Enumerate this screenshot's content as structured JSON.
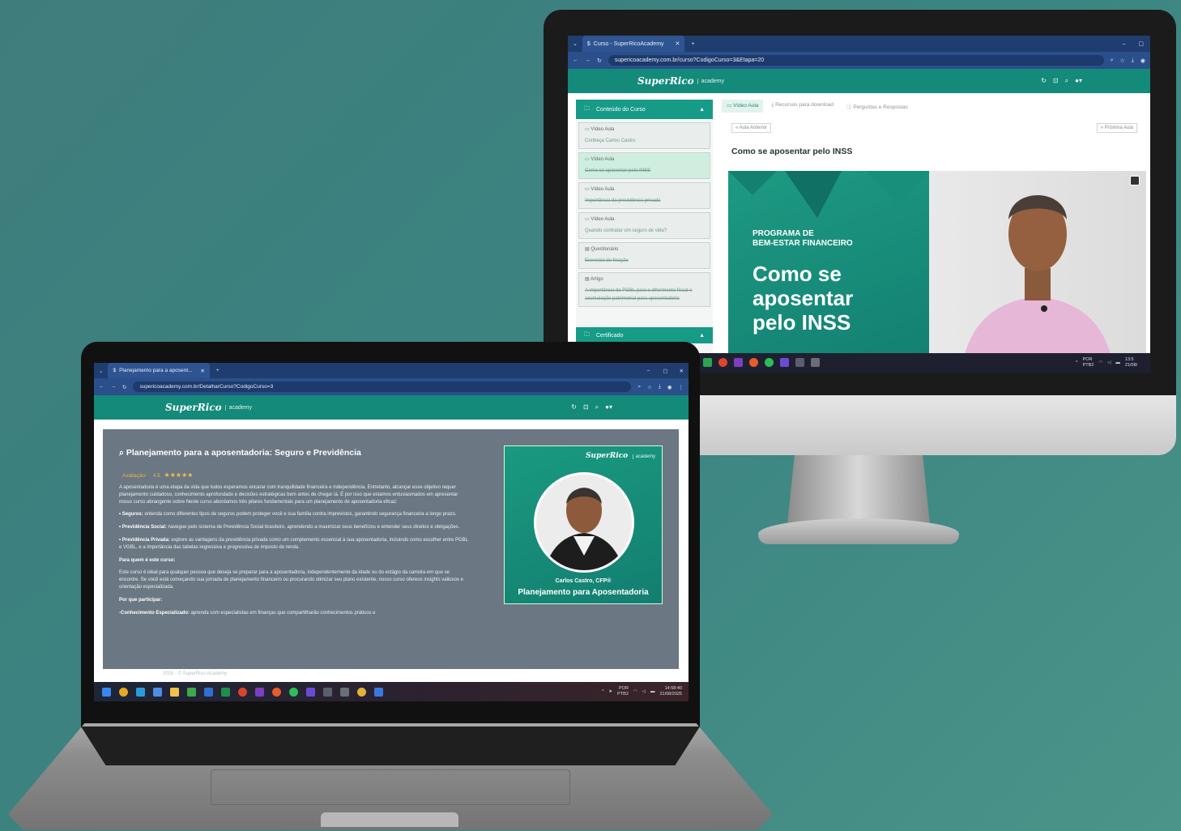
{
  "monitor": {
    "browser": {
      "tab_title": "Curso - SuperRicoAcademy",
      "url": "supericoacademy.com.br/curso?CodigoCurso=3&Etapa=20"
    },
    "app": {
      "logo": "SuperRico",
      "logo_sub": "academy"
    },
    "sidebar": {
      "header": "Conteúdo do Curso",
      "items": [
        {
          "kind": "Vídeo Aula",
          "title": "Conheça Carlos Castro"
        },
        {
          "kind": "Vídeo Aula",
          "title": "Como se aposentar pelo INSS"
        },
        {
          "kind": "Vídeo Aula",
          "title": "Importância da previdência privada"
        },
        {
          "kind": "Vídeo Aula",
          "title": "Quando contratar um seguro de vida?"
        },
        {
          "kind": "Questionário",
          "title": "Exercício de fixação"
        },
        {
          "kind": "Artigo",
          "title": "A importância do PGBL para o diferimento fiscal e acumulação patrimonial para aposentadoria"
        }
      ],
      "certificate": "Certificado"
    },
    "content_tabs": [
      "Vídeo Aula",
      "Recursos para download",
      "Perguntas e Respostas"
    ],
    "prev_label": "« Aula Anterior",
    "next_label": "» Próxima Aula",
    "lesson_title": "Como se aposentar pelo INSS",
    "video": {
      "program_line1": "PROGRAMA DE",
      "program_line2": "BEM-ESTAR FINANCEIRO",
      "headline_1": "Como se",
      "headline_2": "aposentar",
      "headline_3": "pelo INSS"
    },
    "tray": {
      "lang": "POR",
      "kb": "PTB2",
      "time": "13:5",
      "date": "21/08/"
    }
  },
  "laptop": {
    "browser": {
      "tab_title": "Planejamento para a aposent...",
      "url": "supericoacademy.com.br/DetalharCurso?CodigoCurso=3"
    },
    "app": {
      "logo": "SuperRico",
      "logo_sub": "academy"
    },
    "course": {
      "title": "Planejamento para a aposentadoria: Seguro e Previdência",
      "rating_label": "Avaliação:",
      "rating_value": "4.5",
      "stars": "★★★★★",
      "intro": "A aposentadoria é uma etapa da vida que todos esperamos encarar com tranquilidade financeira e independência. Entretanto, alcançar esse objetivo requer planejamento cuidadoso, conhecimento aprofundado e decisões estratégicas bem antes de chegar lá. É por isso que estamos entusiasmados em apresentar nosso curso abrangente sobre Neste curso abordamos três pilares fundamentais para um planejamento de aposentadoria eficaz:",
      "b1_label": "• Seguros:",
      "b1_text": " entenda como diferentes tipos de seguros podem proteger você e sua família contra imprevistos, garantindo segurança financeira a longo prazo.",
      "b2_label": "• Previdência Social:",
      "b2_text": " navegue pelo sistema de Previdência Social brasileiro, aprendendo a maximizar seus benefícios e entender seus direitos e obrigações.",
      "b3_label": "• Previdência Privada:",
      "b3_text": " explore as vantagens da previdência privada como um complemento essencial à sua aposentadoria, incluindo como escolher entre PGBL e VGBL, e a importância das tabelas regressiva e progressiva de imposto de renda.",
      "audience_heading": "Para quem é este curso:",
      "audience_text": "Este curso é ideal para qualquer pessoa que deseja se preparar para a aposentadoria, independentemente da idade ou do estágio da carreira em que se encontre. Se você está começando sua jornada de planejamento financeiro ou procurando otimizar seu plano existente, nosso curso oferece insights valiosos e orientação especializada.",
      "why_heading": "Por que participar:",
      "why_label": "-Conhecimento Especializado:",
      "why_text": " aprenda com especialistas em finanças que compartilharão conhecimentos práticos e"
    },
    "card": {
      "logo": "SuperRico",
      "logo_sub": "academy",
      "name": "Carlos Castro, CFP®",
      "title": "Planejamento para Aposentadoria"
    },
    "footer": "2025 - © SuperRico Academy",
    "tray": {
      "lang": "POR",
      "kb": "PTB2",
      "time": "14:58:40",
      "date": "21/08/2025"
    }
  }
}
